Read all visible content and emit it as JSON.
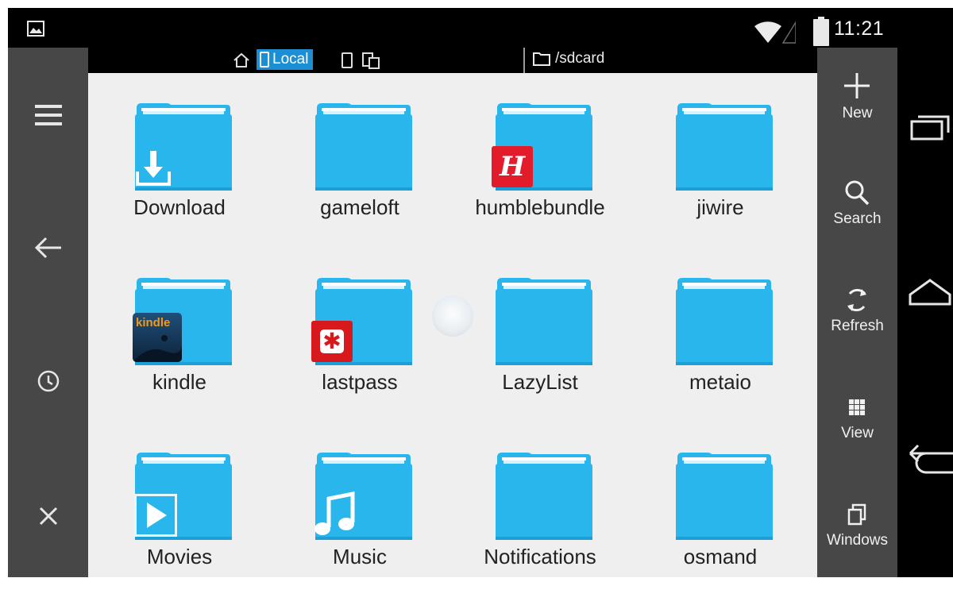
{
  "status_bar": {
    "time": "11:21"
  },
  "path_bar": {
    "location_label": "Local",
    "current_path": "/sdcard"
  },
  "left_drawer": {
    "items": [
      "menu-icon",
      "back-arrow-icon",
      "history-clock-icon",
      "close-icon"
    ]
  },
  "folders": [
    {
      "name": "Download",
      "badge": "download"
    },
    {
      "name": "gameloft",
      "badge": ""
    },
    {
      "name": "humblebundle",
      "badge": "humble"
    },
    {
      "name": "jiwire",
      "badge": ""
    },
    {
      "name": "kindle",
      "badge": "kindle"
    },
    {
      "name": "lastpass",
      "badge": "lastpass"
    },
    {
      "name": "LazyList",
      "badge": ""
    },
    {
      "name": "metaio",
      "badge": ""
    },
    {
      "name": "Movies",
      "badge": "movies"
    },
    {
      "name": "Music",
      "badge": "music"
    },
    {
      "name": "Notifications",
      "badge": ""
    },
    {
      "name": "osmand",
      "badge": ""
    }
  ],
  "badge_text": {
    "humble": "H",
    "kindle": "kindle",
    "lastpass": "✱"
  },
  "action_bar": {
    "new_label": "New",
    "search_label": "Search",
    "refresh_label": "Refresh",
    "view_label": "View",
    "windows_label": "Windows"
  },
  "colors": {
    "folder": "#29b6ec",
    "folder_dark": "#1a9fd6",
    "accent": "#1a8fd3",
    "sidebar": "#474747",
    "content_bg": "#efefef"
  }
}
